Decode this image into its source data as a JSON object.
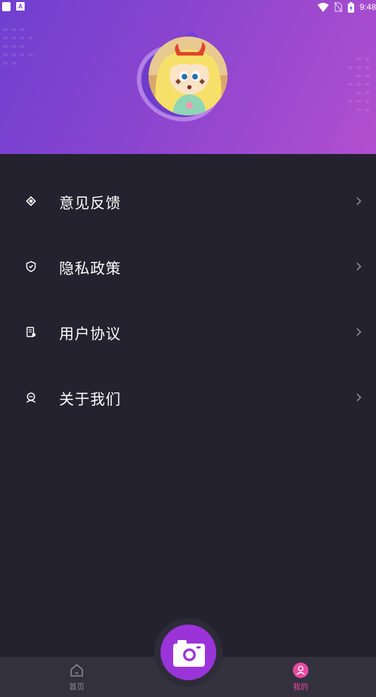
{
  "status_bar": {
    "time": "9:48",
    "left_icons": [
      "app-notification-icon",
      "a-notification-icon"
    ],
    "right_icons": [
      "wifi-icon",
      "no-sim-icon",
      "battery-icon"
    ]
  },
  "profile": {
    "avatar_icon": "avatar-cartoon-girl"
  },
  "menu": {
    "items": [
      {
        "label": "意见反馈",
        "icon": "feedback-icon"
      },
      {
        "label": "隐私政策",
        "icon": "shield-icon"
      },
      {
        "label": "用户协议",
        "icon": "document-icon"
      },
      {
        "label": "关于我们",
        "icon": "about-icon"
      }
    ]
  },
  "tabbar": {
    "tabs": [
      {
        "label": "首页",
        "icon": "home-icon",
        "active": false
      },
      {
        "label": "我的",
        "icon": "profile-icon",
        "active": true
      }
    ],
    "camera_icon": "camera-icon"
  },
  "colors": {
    "header_gradient_start": "#6f3fd0",
    "header_gradient_end": "#b14fcf",
    "background": "#23222e",
    "tabbar": "#34313f",
    "accent": "#9a34d8",
    "active_tab": "#e64aa0",
    "inactive_tab": "#8f8c98"
  }
}
